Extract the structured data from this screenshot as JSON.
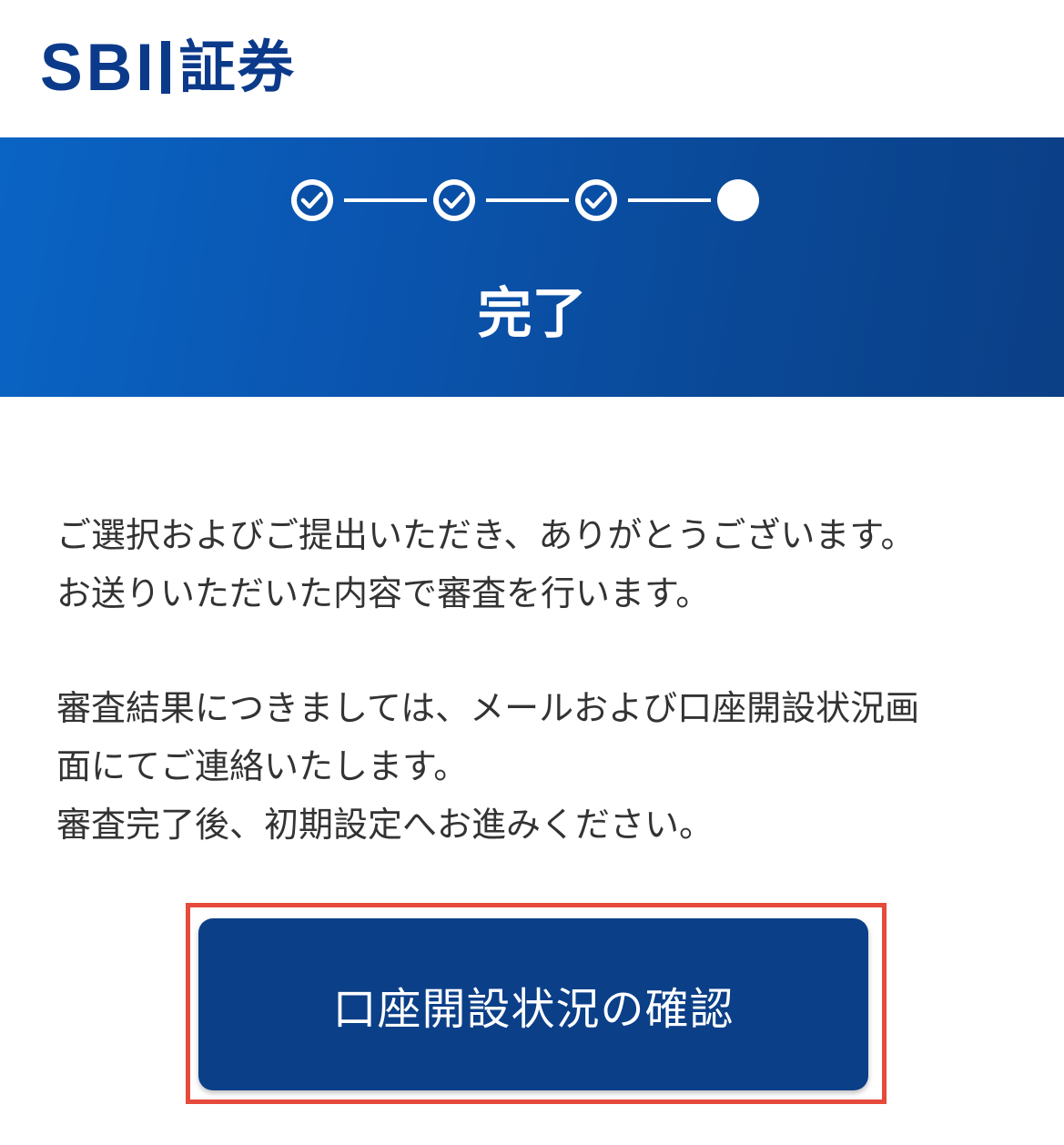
{
  "header": {
    "logo_latin": "SBI",
    "logo_kanji": "証券"
  },
  "progress": {
    "steps": [
      "done",
      "done",
      "done",
      "current"
    ],
    "title": "完了"
  },
  "message": {
    "paragraph1": [
      "ご選択およびご提出いただき、ありがとうございます。",
      "お送りいただいた内容で審査を行います。"
    ],
    "paragraph2": [
      "審査結果につきましては、メールおよび口座開設状況画",
      "面にてご連絡いたします。",
      "審査完了後、初期設定へお進みください。"
    ]
  },
  "actions": {
    "status_button_label": "口座開設状況の確認"
  },
  "colors": {
    "brand": "#0c3a8a",
    "banner_start": "#0a64c4",
    "banner_end": "#0b3f86",
    "button": "#0b3f88",
    "highlight": "#e64a3b"
  }
}
